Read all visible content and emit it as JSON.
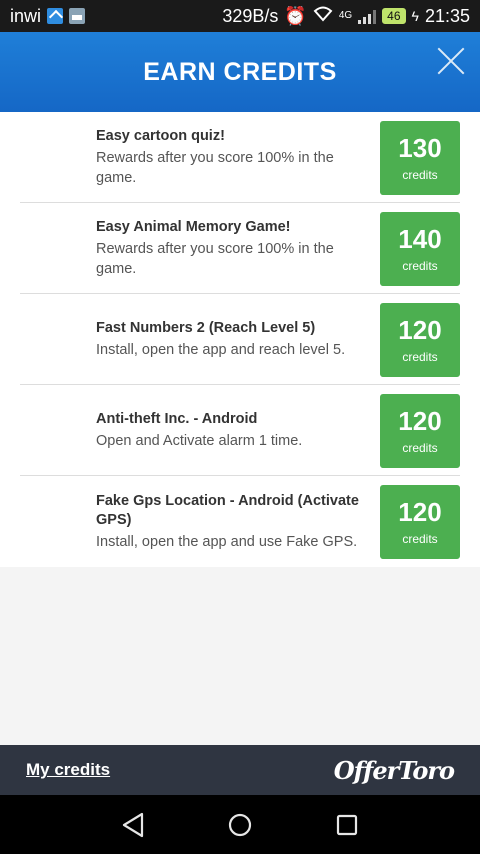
{
  "status_bar": {
    "carrier": "inwi",
    "speed": "329B/s",
    "network": "4G",
    "battery": "46",
    "time": "21:35"
  },
  "header": {
    "title": "EARN CREDITS"
  },
  "offers": [
    {
      "title": "Easy cartoon quiz!",
      "description": "Rewards after you score 100% in the game.",
      "credits": "130",
      "unit": "credits"
    },
    {
      "title": "Easy Animal Memory Game!",
      "description": "Rewards after you score 100% in the game.",
      "credits": "140",
      "unit": "credits"
    },
    {
      "title": "Fast Numbers 2 (Reach Level 5)",
      "description": "Install, open the app and reach level 5.",
      "credits": "120",
      "unit": "credits"
    },
    {
      "title": "Anti-theft Inc. - Android",
      "description": "Open and Activate alarm 1 time.",
      "credits": "120",
      "unit": "credits"
    },
    {
      "title": "Fake Gps Location - Android (Activate GPS)",
      "description": "Install, open the app and use Fake GPS.",
      "credits": "120",
      "unit": "credits"
    }
  ],
  "footer": {
    "my_credits_label": "My credits",
    "brand": "OfferToro"
  },
  "icons": {
    "close": "close-icon",
    "back": "back-triangle-icon",
    "home": "home-circle-icon",
    "recents": "recents-square-icon"
  },
  "colors": {
    "header": "#1567c6",
    "credit_badge": "#4caf50",
    "footer": "#2f3541"
  }
}
